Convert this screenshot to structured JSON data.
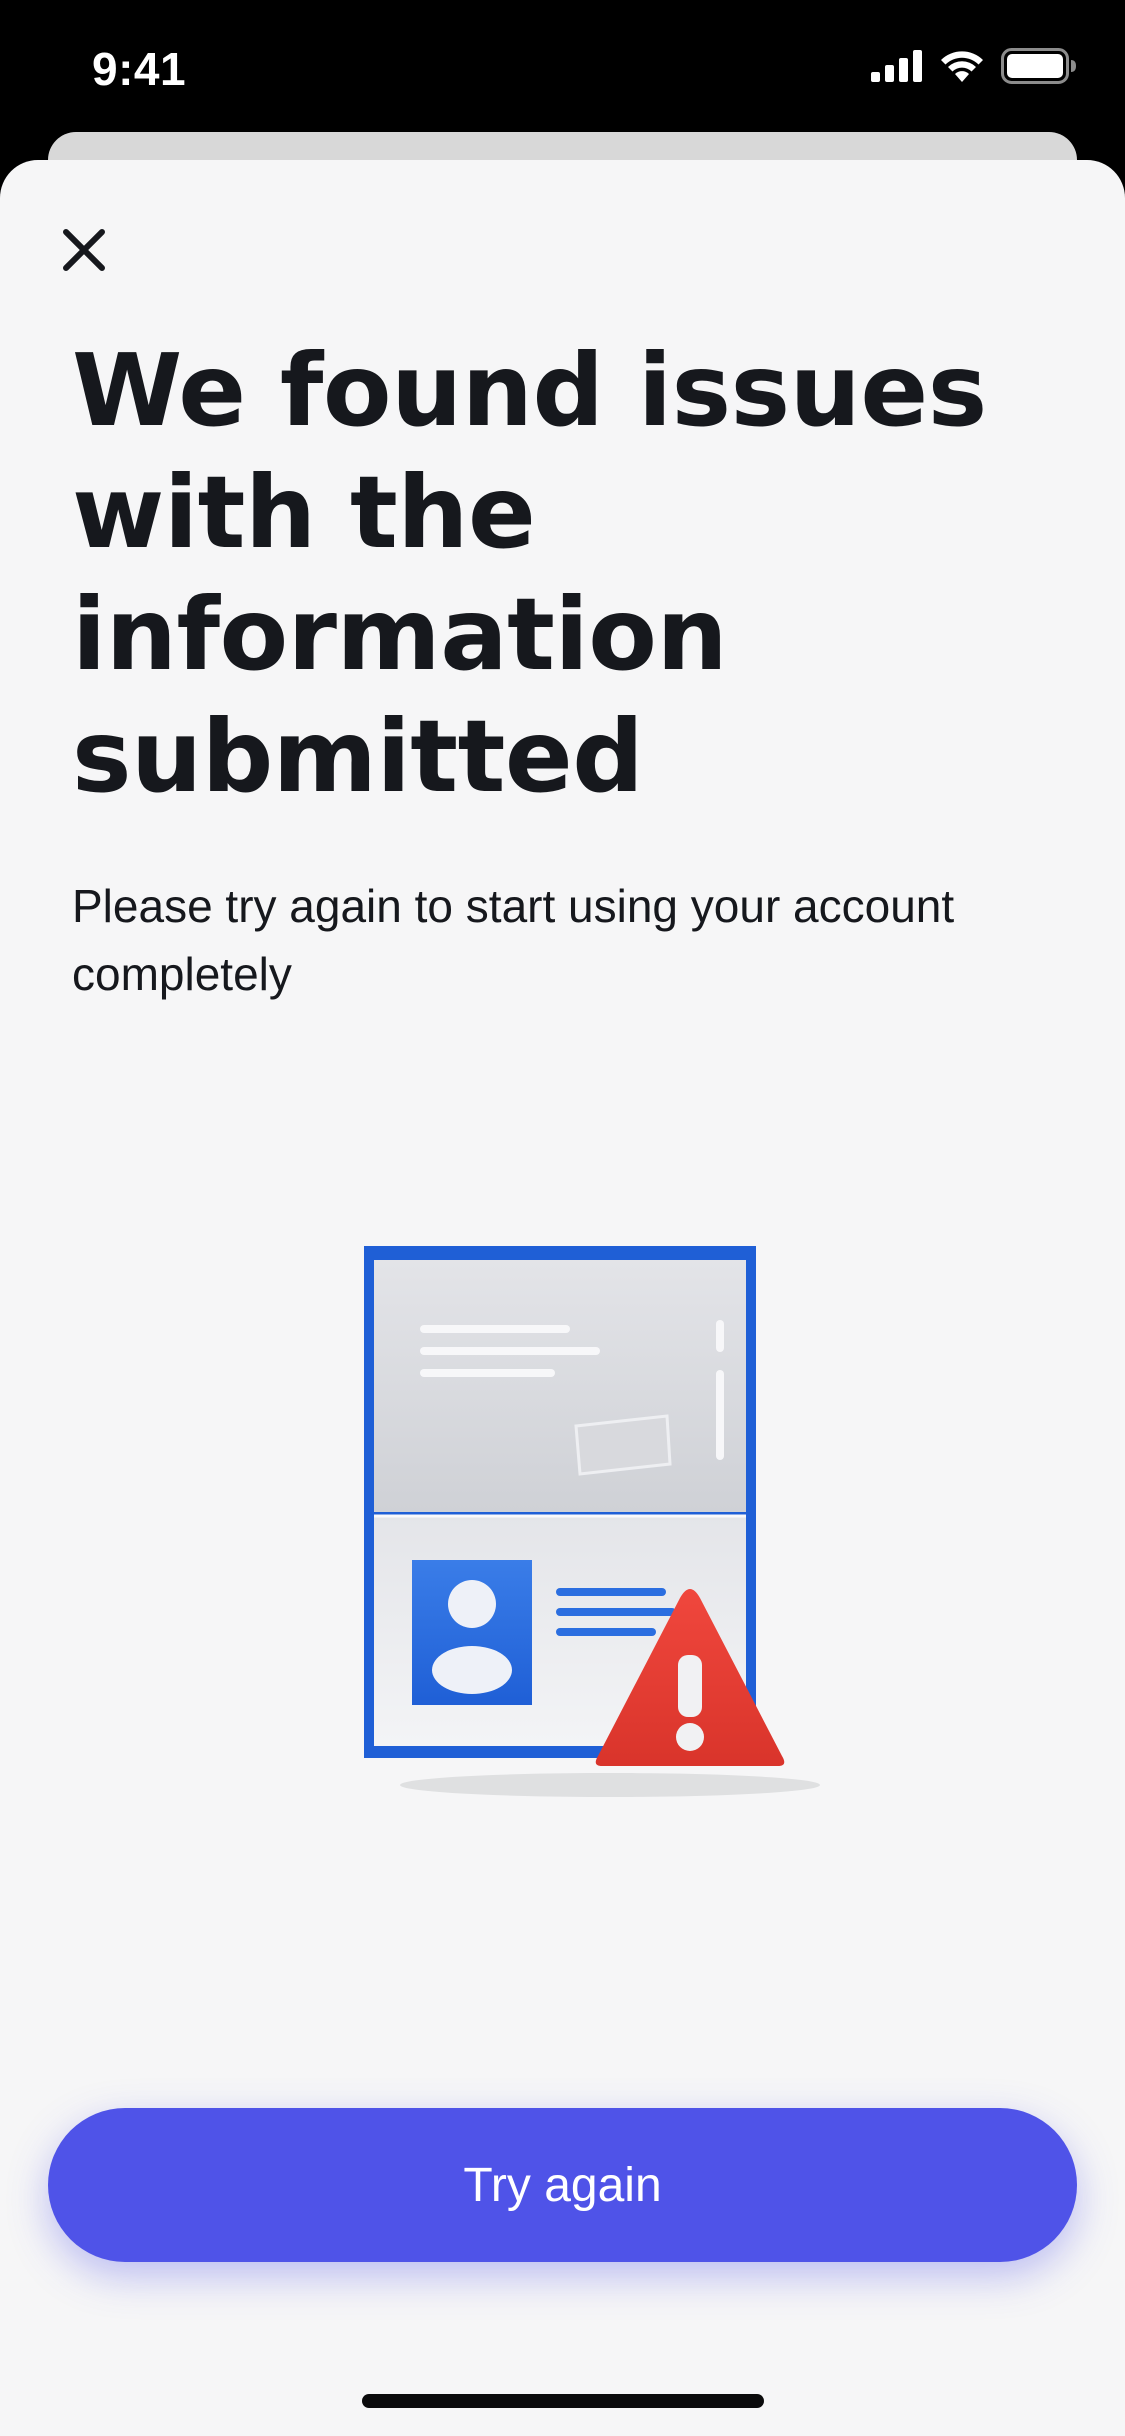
{
  "status_bar": {
    "time": "9:41",
    "icons": [
      "cellular-signal-icon",
      "wifi-icon",
      "battery-icon"
    ]
  },
  "header": {
    "close_icon": "close-icon"
  },
  "content": {
    "title": "We found issues with the information submitted",
    "subtitle": "Please try again to start using your account completely",
    "illustration": "id-document-warning-illustration"
  },
  "actions": {
    "primary_label": "Try again"
  },
  "colors": {
    "primary": "#4f53e8",
    "text": "#16181d",
    "background": "#f6f6f7",
    "warning": "#e53b33",
    "document_blue": "#1f5fd6"
  }
}
